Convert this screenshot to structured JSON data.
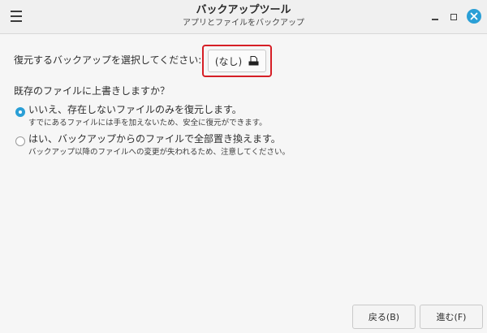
{
  "window": {
    "title": "バックアップツール",
    "subtitle": "アプリとファイルをバックアップ",
    "menu_icon": "hamburger-menu-icon",
    "controls": [
      "minimize-icon",
      "maximize-icon",
      "close-icon"
    ],
    "accent_color": "#2a9fd6",
    "highlight_color": "#d61f26"
  },
  "selection": {
    "prompt": "復元するバックアップを選択してください:",
    "file_button_label": "(なし)",
    "file_button_icon": "file-icon"
  },
  "overwrite": {
    "question": "既存のファイルに上書きしますか？",
    "options": [
      {
        "label": "いいえ、存在しないファイルのみを復元します。",
        "description": "すでにあるファイルには手を加えないため、安全に復元ができます。",
        "selected": true
      },
      {
        "label": "はい、バックアップからのファイルで全部置き換えます。",
        "description": "バックアップ以降のファイルへの変更が失われるため、注意してください。",
        "selected": false
      }
    ]
  },
  "footer": {
    "back_label": "戻る(B)",
    "next_label": "進む(F)"
  }
}
